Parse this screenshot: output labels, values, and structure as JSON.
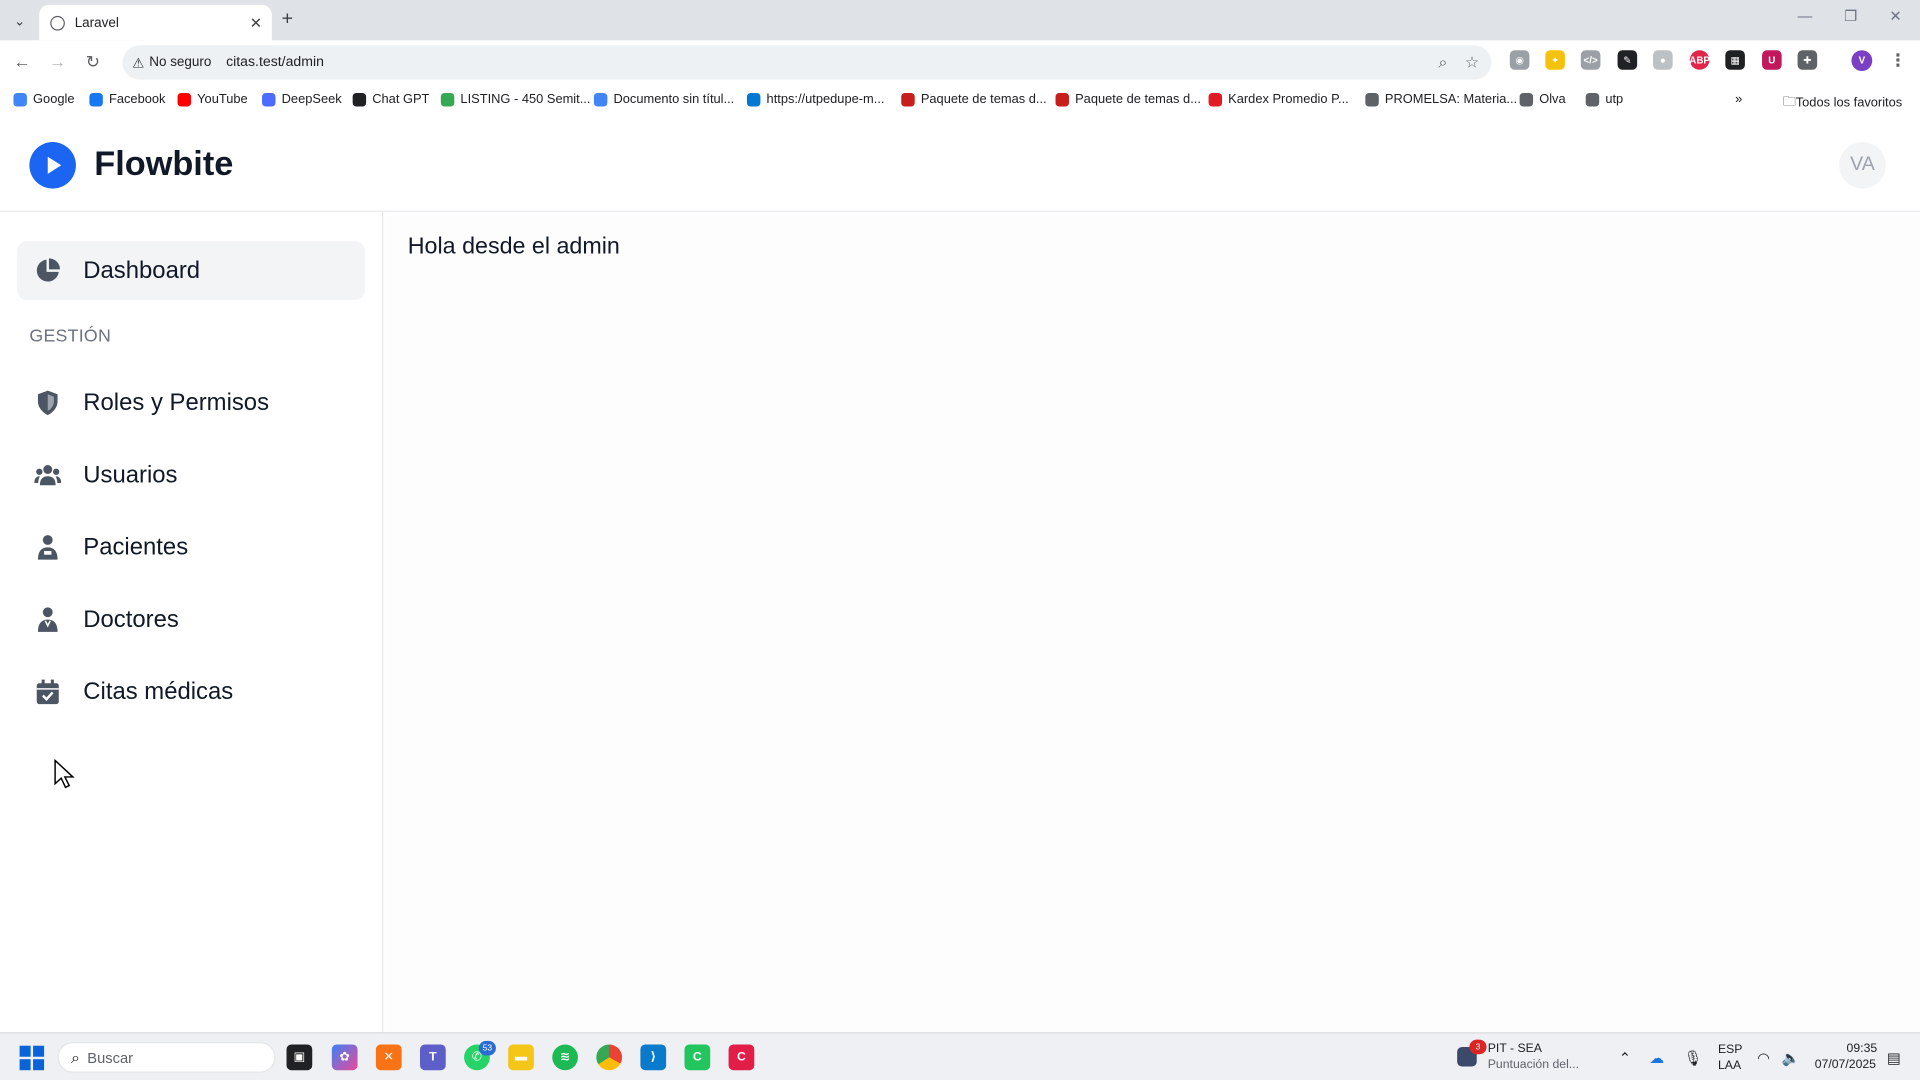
{
  "browser": {
    "tab_title": "Laravel",
    "security_label": "No seguro",
    "url": "citas.test/admin",
    "bookmarks": [
      {
        "label": "Google",
        "color": "#4285f4"
      },
      {
        "label": "Facebook",
        "color": "#1877f2"
      },
      {
        "label": "YouTube",
        "color": "#ff0000"
      },
      {
        "label": "DeepSeek",
        "color": "#4d6bfe"
      },
      {
        "label": "Chat GPT",
        "color": "#202124"
      },
      {
        "label": "LISTING - 450 Semit...",
        "color": "#34a853"
      },
      {
        "label": "Documento sin títul...",
        "color": "#4285f4"
      },
      {
        "label": "https://utpedupe-m...",
        "color": "#0078d4"
      },
      {
        "label": "Paquete de temas d...",
        "color": "#c81d1d"
      },
      {
        "label": "Paquete de temas d...",
        "color": "#c81d1d"
      },
      {
        "label": "Kardex Promedio P...",
        "color": "#e01b24"
      },
      {
        "label": "PROMELSA: Materia...",
        "color": "#5f6368"
      },
      {
        "label": "Olva",
        "color": "#5f6368"
      },
      {
        "label": "utp",
        "color": "#5f6368"
      }
    ],
    "all_bookmarks_label": "Todos los favoritos",
    "profile_initial": "V"
  },
  "app": {
    "brand": "Flowbite",
    "avatar_initials": "VA",
    "brand_color": "#1c64f2"
  },
  "sidebar": {
    "dashboard_label": "Dashboard",
    "section_heading": "GESTIÓN",
    "items": [
      {
        "label": "Roles y Permisos",
        "icon": "shield-icon"
      },
      {
        "label": "Usuarios",
        "icon": "users-icon"
      },
      {
        "label": "Pacientes",
        "icon": "patient-icon"
      },
      {
        "label": "Doctores",
        "icon": "doctor-icon"
      },
      {
        "label": "Citas médicas",
        "icon": "calendar-check-icon"
      }
    ]
  },
  "main": {
    "greeting": "Hola desde el admin"
  },
  "taskbar": {
    "search_placeholder": "Buscar",
    "whatsapp_badge": "53",
    "notification_badge": "3",
    "notification_title": "PIT - SEA",
    "notification_subtitle": "Puntuación del...",
    "lang_1": "ESP",
    "lang_2": "LAA",
    "time": "09:35",
    "date": "07/07/2025"
  }
}
